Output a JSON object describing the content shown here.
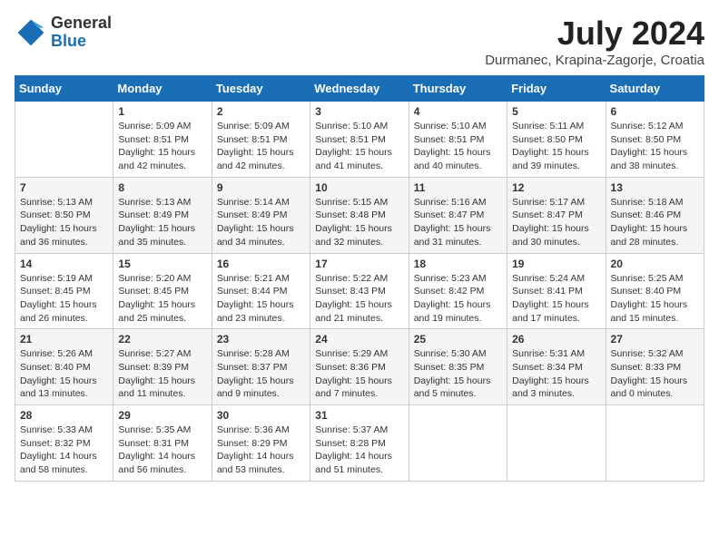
{
  "header": {
    "logo_general": "General",
    "logo_blue": "Blue",
    "month_year": "July 2024",
    "location": "Durmanec, Krapina-Zagorje, Croatia"
  },
  "calendar": {
    "days_of_week": [
      "Sunday",
      "Monday",
      "Tuesday",
      "Wednesday",
      "Thursday",
      "Friday",
      "Saturday"
    ],
    "weeks": [
      [
        {
          "day": "",
          "info": ""
        },
        {
          "day": "1",
          "info": "Sunrise: 5:09 AM\nSunset: 8:51 PM\nDaylight: 15 hours\nand 42 minutes."
        },
        {
          "day": "2",
          "info": "Sunrise: 5:09 AM\nSunset: 8:51 PM\nDaylight: 15 hours\nand 42 minutes."
        },
        {
          "day": "3",
          "info": "Sunrise: 5:10 AM\nSunset: 8:51 PM\nDaylight: 15 hours\nand 41 minutes."
        },
        {
          "day": "4",
          "info": "Sunrise: 5:10 AM\nSunset: 8:51 PM\nDaylight: 15 hours\nand 40 minutes."
        },
        {
          "day": "5",
          "info": "Sunrise: 5:11 AM\nSunset: 8:50 PM\nDaylight: 15 hours\nand 39 minutes."
        },
        {
          "day": "6",
          "info": "Sunrise: 5:12 AM\nSunset: 8:50 PM\nDaylight: 15 hours\nand 38 minutes."
        }
      ],
      [
        {
          "day": "7",
          "info": "Sunrise: 5:13 AM\nSunset: 8:50 PM\nDaylight: 15 hours\nand 36 minutes."
        },
        {
          "day": "8",
          "info": "Sunrise: 5:13 AM\nSunset: 8:49 PM\nDaylight: 15 hours\nand 35 minutes."
        },
        {
          "day": "9",
          "info": "Sunrise: 5:14 AM\nSunset: 8:49 PM\nDaylight: 15 hours\nand 34 minutes."
        },
        {
          "day": "10",
          "info": "Sunrise: 5:15 AM\nSunset: 8:48 PM\nDaylight: 15 hours\nand 32 minutes."
        },
        {
          "day": "11",
          "info": "Sunrise: 5:16 AM\nSunset: 8:47 PM\nDaylight: 15 hours\nand 31 minutes."
        },
        {
          "day": "12",
          "info": "Sunrise: 5:17 AM\nSunset: 8:47 PM\nDaylight: 15 hours\nand 30 minutes."
        },
        {
          "day": "13",
          "info": "Sunrise: 5:18 AM\nSunset: 8:46 PM\nDaylight: 15 hours\nand 28 minutes."
        }
      ],
      [
        {
          "day": "14",
          "info": "Sunrise: 5:19 AM\nSunset: 8:45 PM\nDaylight: 15 hours\nand 26 minutes."
        },
        {
          "day": "15",
          "info": "Sunrise: 5:20 AM\nSunset: 8:45 PM\nDaylight: 15 hours\nand 25 minutes."
        },
        {
          "day": "16",
          "info": "Sunrise: 5:21 AM\nSunset: 8:44 PM\nDaylight: 15 hours\nand 23 minutes."
        },
        {
          "day": "17",
          "info": "Sunrise: 5:22 AM\nSunset: 8:43 PM\nDaylight: 15 hours\nand 21 minutes."
        },
        {
          "day": "18",
          "info": "Sunrise: 5:23 AM\nSunset: 8:42 PM\nDaylight: 15 hours\nand 19 minutes."
        },
        {
          "day": "19",
          "info": "Sunrise: 5:24 AM\nSunset: 8:41 PM\nDaylight: 15 hours\nand 17 minutes."
        },
        {
          "day": "20",
          "info": "Sunrise: 5:25 AM\nSunset: 8:40 PM\nDaylight: 15 hours\nand 15 minutes."
        }
      ],
      [
        {
          "day": "21",
          "info": "Sunrise: 5:26 AM\nSunset: 8:40 PM\nDaylight: 15 hours\nand 13 minutes."
        },
        {
          "day": "22",
          "info": "Sunrise: 5:27 AM\nSunset: 8:39 PM\nDaylight: 15 hours\nand 11 minutes."
        },
        {
          "day": "23",
          "info": "Sunrise: 5:28 AM\nSunset: 8:37 PM\nDaylight: 15 hours\nand 9 minutes."
        },
        {
          "day": "24",
          "info": "Sunrise: 5:29 AM\nSunset: 8:36 PM\nDaylight: 15 hours\nand 7 minutes."
        },
        {
          "day": "25",
          "info": "Sunrise: 5:30 AM\nSunset: 8:35 PM\nDaylight: 15 hours\nand 5 minutes."
        },
        {
          "day": "26",
          "info": "Sunrise: 5:31 AM\nSunset: 8:34 PM\nDaylight: 15 hours\nand 3 minutes."
        },
        {
          "day": "27",
          "info": "Sunrise: 5:32 AM\nSunset: 8:33 PM\nDaylight: 15 hours\nand 0 minutes."
        }
      ],
      [
        {
          "day": "28",
          "info": "Sunrise: 5:33 AM\nSunset: 8:32 PM\nDaylight: 14 hours\nand 58 minutes."
        },
        {
          "day": "29",
          "info": "Sunrise: 5:35 AM\nSunset: 8:31 PM\nDaylight: 14 hours\nand 56 minutes."
        },
        {
          "day": "30",
          "info": "Sunrise: 5:36 AM\nSunset: 8:29 PM\nDaylight: 14 hours\nand 53 minutes."
        },
        {
          "day": "31",
          "info": "Sunrise: 5:37 AM\nSunset: 8:28 PM\nDaylight: 14 hours\nand 51 minutes."
        },
        {
          "day": "",
          "info": ""
        },
        {
          "day": "",
          "info": ""
        },
        {
          "day": "",
          "info": ""
        }
      ]
    ]
  }
}
